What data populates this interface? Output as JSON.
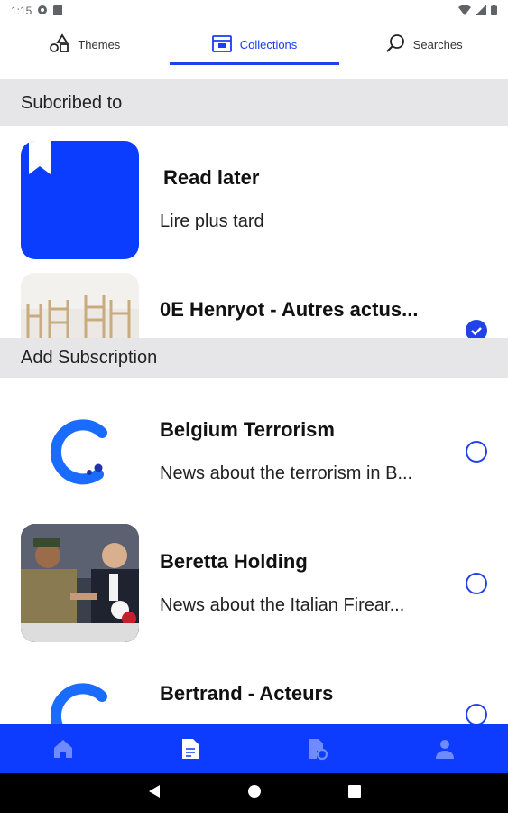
{
  "status_bar": {
    "time": "1:15"
  },
  "tabs": [
    {
      "label": "Themes",
      "icon": "shapes-icon",
      "active": false
    },
    {
      "label": "Collections",
      "icon": "collection-icon",
      "active": true
    },
    {
      "label": "Searches",
      "icon": "search-icon",
      "active": false
    }
  ],
  "subscribed": {
    "header": "Subcribed to",
    "items": [
      {
        "title": "Read later",
        "description": "Lire plus tard",
        "thumb": "bookmark-tile"
      },
      {
        "title": "0E Henryot - Autres actus...",
        "description": "",
        "thumb": "photo-chairs",
        "selected": true
      }
    ]
  },
  "add_subscription": {
    "header": "Add Subscription",
    "items": [
      {
        "title": "Belgium Terrorism",
        "description": "News about the terrorism in B...",
        "thumb": "logo-c",
        "selected": false
      },
      {
        "title": "Beretta Holding",
        "description": "News about the Italian Firear...",
        "thumb": "photo-handshake",
        "selected": false
      },
      {
        "title": "Bertrand - Acteurs",
        "description": "",
        "thumb": "logo-c",
        "selected": false
      }
    ]
  },
  "bottom_nav": [
    {
      "icon": "home-icon"
    },
    {
      "icon": "document-icon",
      "active": true
    },
    {
      "icon": "document-settings-icon"
    },
    {
      "icon": "person-icon"
    }
  ],
  "colors": {
    "accent": "#2142e8",
    "nav_bg": "#0d3cff",
    "section_bg": "#e6e6e8"
  }
}
